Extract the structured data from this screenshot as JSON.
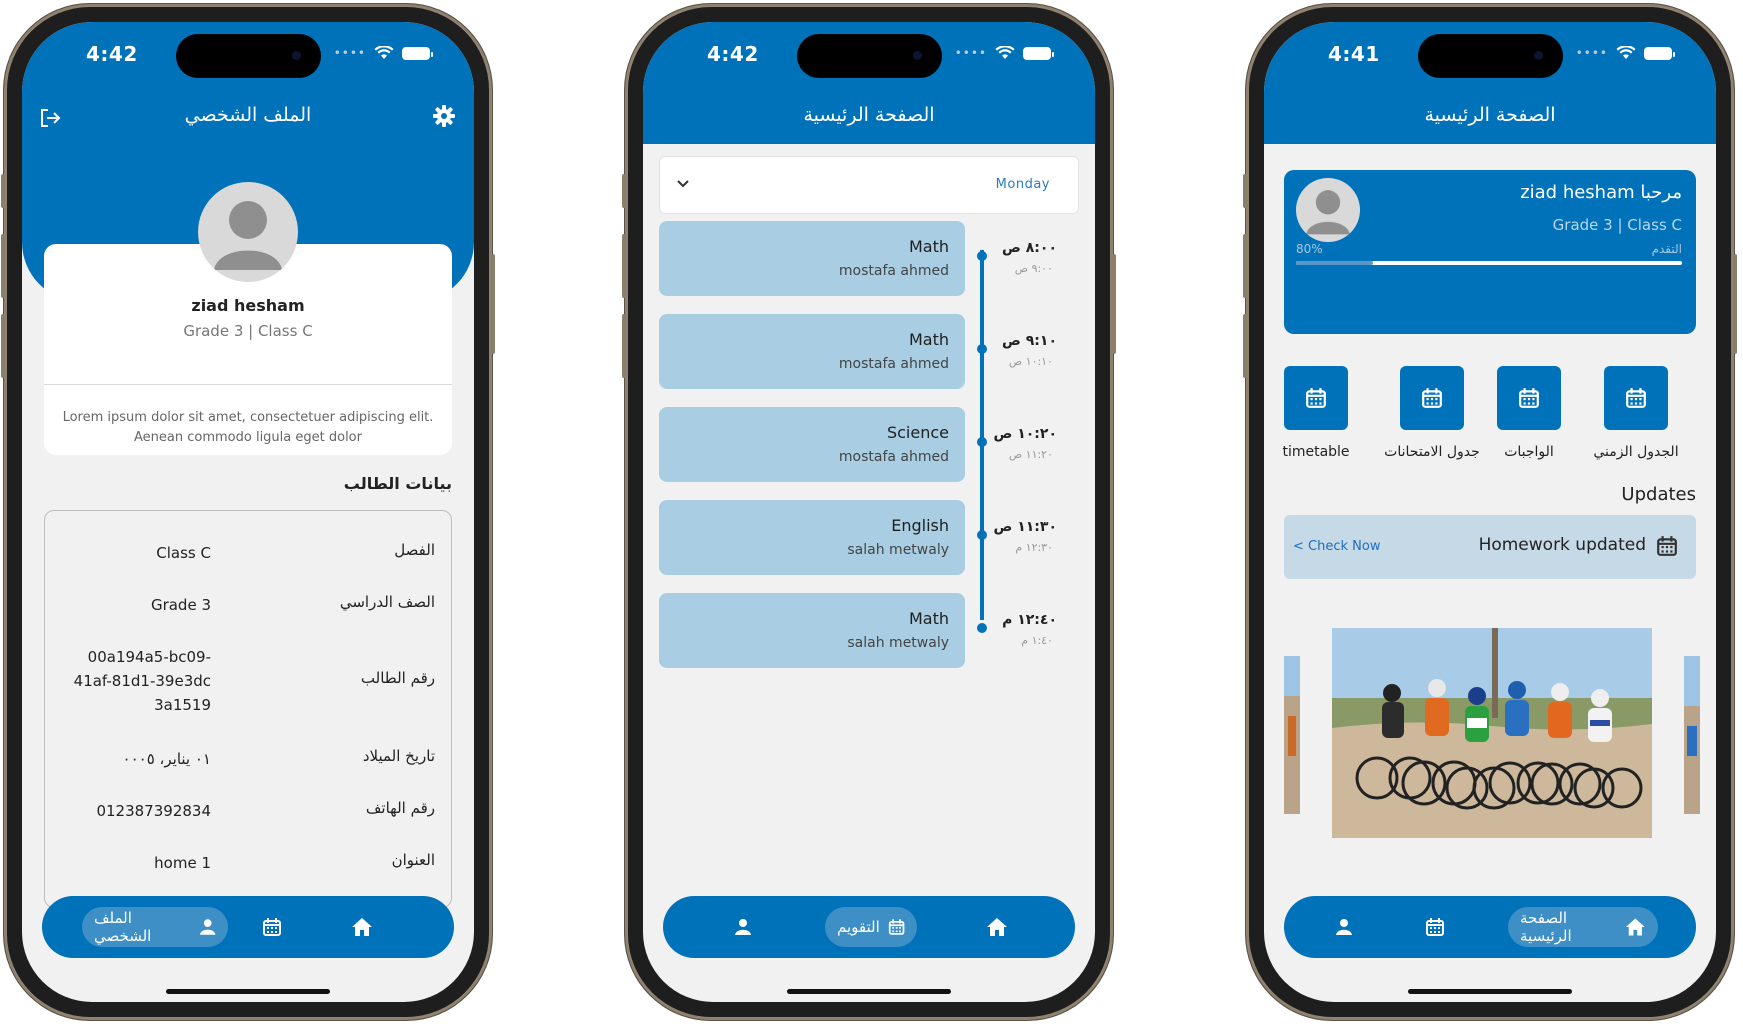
{
  "phone1": {
    "status_time": "4:42",
    "header_title": "الملف الشخصي",
    "profile": {
      "name": "ziad hesham",
      "grade_class": "Grade 3 | Class C",
      "description": "Lorem ipsum dolor sit amet, consectetuer adipiscing elit. Aenean commodo ligula eget dolor"
    },
    "section_title": "بيانات الطالب",
    "info_rows": [
      {
        "key": "الفصل",
        "value": "Class C"
      },
      {
        "key": "الصف الدراسي",
        "value": "Grade 3"
      },
      {
        "key": "رقم الطالب",
        "value": "00a194a5-bc09-\n41af-81d1-39e3dc\n3a1519"
      },
      {
        "key": "تاريخ الميلاد",
        "value": "٠١ يناير، ٠٠٠٥"
      },
      {
        "key": "رقم الهاتف",
        "value": "012387392834"
      },
      {
        "key": "العنوان",
        "value": "home 1"
      }
    ],
    "nav": {
      "active_label": "الملف الشخصي"
    }
  },
  "phone2": {
    "status_time": "4:42",
    "header_title": "الصفحة الرئيسية",
    "day_select": "Monday",
    "lessons": [
      {
        "subject": "Math",
        "teacher": "mostafa ahmed",
        "start": "٨:٠٠ ص",
        "end": "٩:٠٠ ص"
      },
      {
        "subject": "Math",
        "teacher": "mostafa ahmed",
        "start": "٩:١٠ ص",
        "end": "١٠:١٠ ص"
      },
      {
        "subject": "Science",
        "teacher": "mostafa ahmed",
        "start": "١٠:٢٠ ص",
        "end": "١١:٢٠ ص"
      },
      {
        "subject": "English",
        "teacher": "salah metwaly",
        "start": "١١:٣٠ ص",
        "end": "١٢:٣٠ م"
      },
      {
        "subject": "Math",
        "teacher": "salah metwaly",
        "start": "١٢:٤٠ م",
        "end": "١:٤٠ م"
      }
    ],
    "nav": {
      "active_label": "التقويم"
    }
  },
  "phone3": {
    "status_time": "4:41",
    "header_title": "الصفحة الرئيسية",
    "welcome": {
      "title": "مرحبا ziad hesham",
      "grade_class": "Grade 3 | Class C",
      "progress_percent_label": "80%",
      "progress_label": "التقدم",
      "progress_value": 0.2
    },
    "quick_actions": [
      {
        "label": "الجدول الزمني",
        "icon": "calendar-icon"
      },
      {
        "label": "الواجبات",
        "icon": "calendar-icon"
      },
      {
        "label": "جدول الامتحانات",
        "icon": "calendar-icon"
      },
      {
        "label": "timetable",
        "icon": "calendar-icon"
      }
    ],
    "updates_title": "Updates",
    "update_item": {
      "text": "Homework updated",
      "link": "< Check Now"
    },
    "nav": {
      "active_label": "الصفحة الرئيسية"
    }
  },
  "colors": {
    "primary": "#0072ba",
    "lesson_card": "#a9cde3",
    "update_bar": "#c6d9e6",
    "background": "#f1f1f1"
  }
}
